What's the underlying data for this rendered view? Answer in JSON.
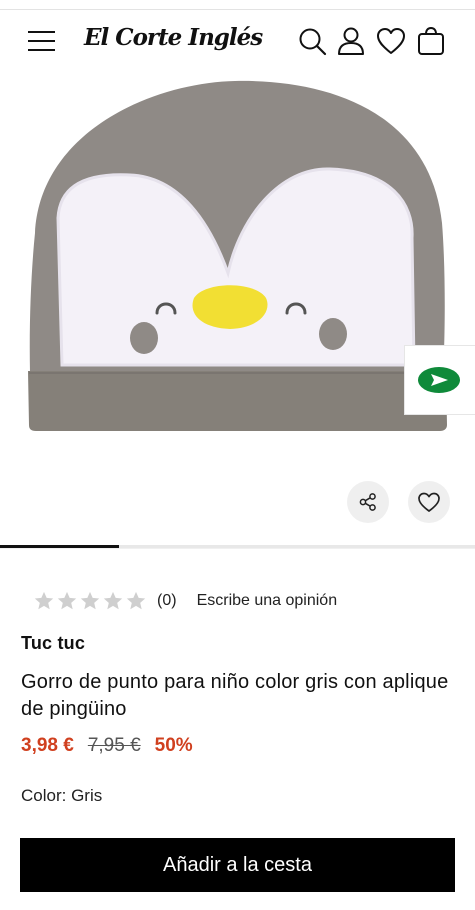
{
  "header": {
    "logo_text": "El Corte Inglés",
    "icons": [
      "menu-icon",
      "search-icon",
      "user-icon",
      "heart-icon",
      "bag-icon"
    ]
  },
  "gallery": {
    "image_subject": "gorro gris con aplique de pingüino",
    "progress": 0.25,
    "actions": [
      "share-icon",
      "wishlist-icon"
    ],
    "chat_icon": "chat-arrow-icon"
  },
  "rating": {
    "stars": 0,
    "max_stars": 5,
    "count_label": "(0)",
    "review_link": "Escribe una opinión"
  },
  "product": {
    "brand": "Tuc tuc",
    "title": "Gorro de punto para niño color gris con aplique de pingüino",
    "price_sale": "3,98 €",
    "price_original": "7,95 €",
    "discount": "50%",
    "color_label": "Color: Gris"
  },
  "cta": {
    "add_to_cart": "Añadir a la cesta"
  },
  "colors": {
    "sale_red": "#d0401f",
    "button_black": "#000000",
    "hat_gray": "#8f8a86",
    "chat_green": "#0f8a3a"
  }
}
